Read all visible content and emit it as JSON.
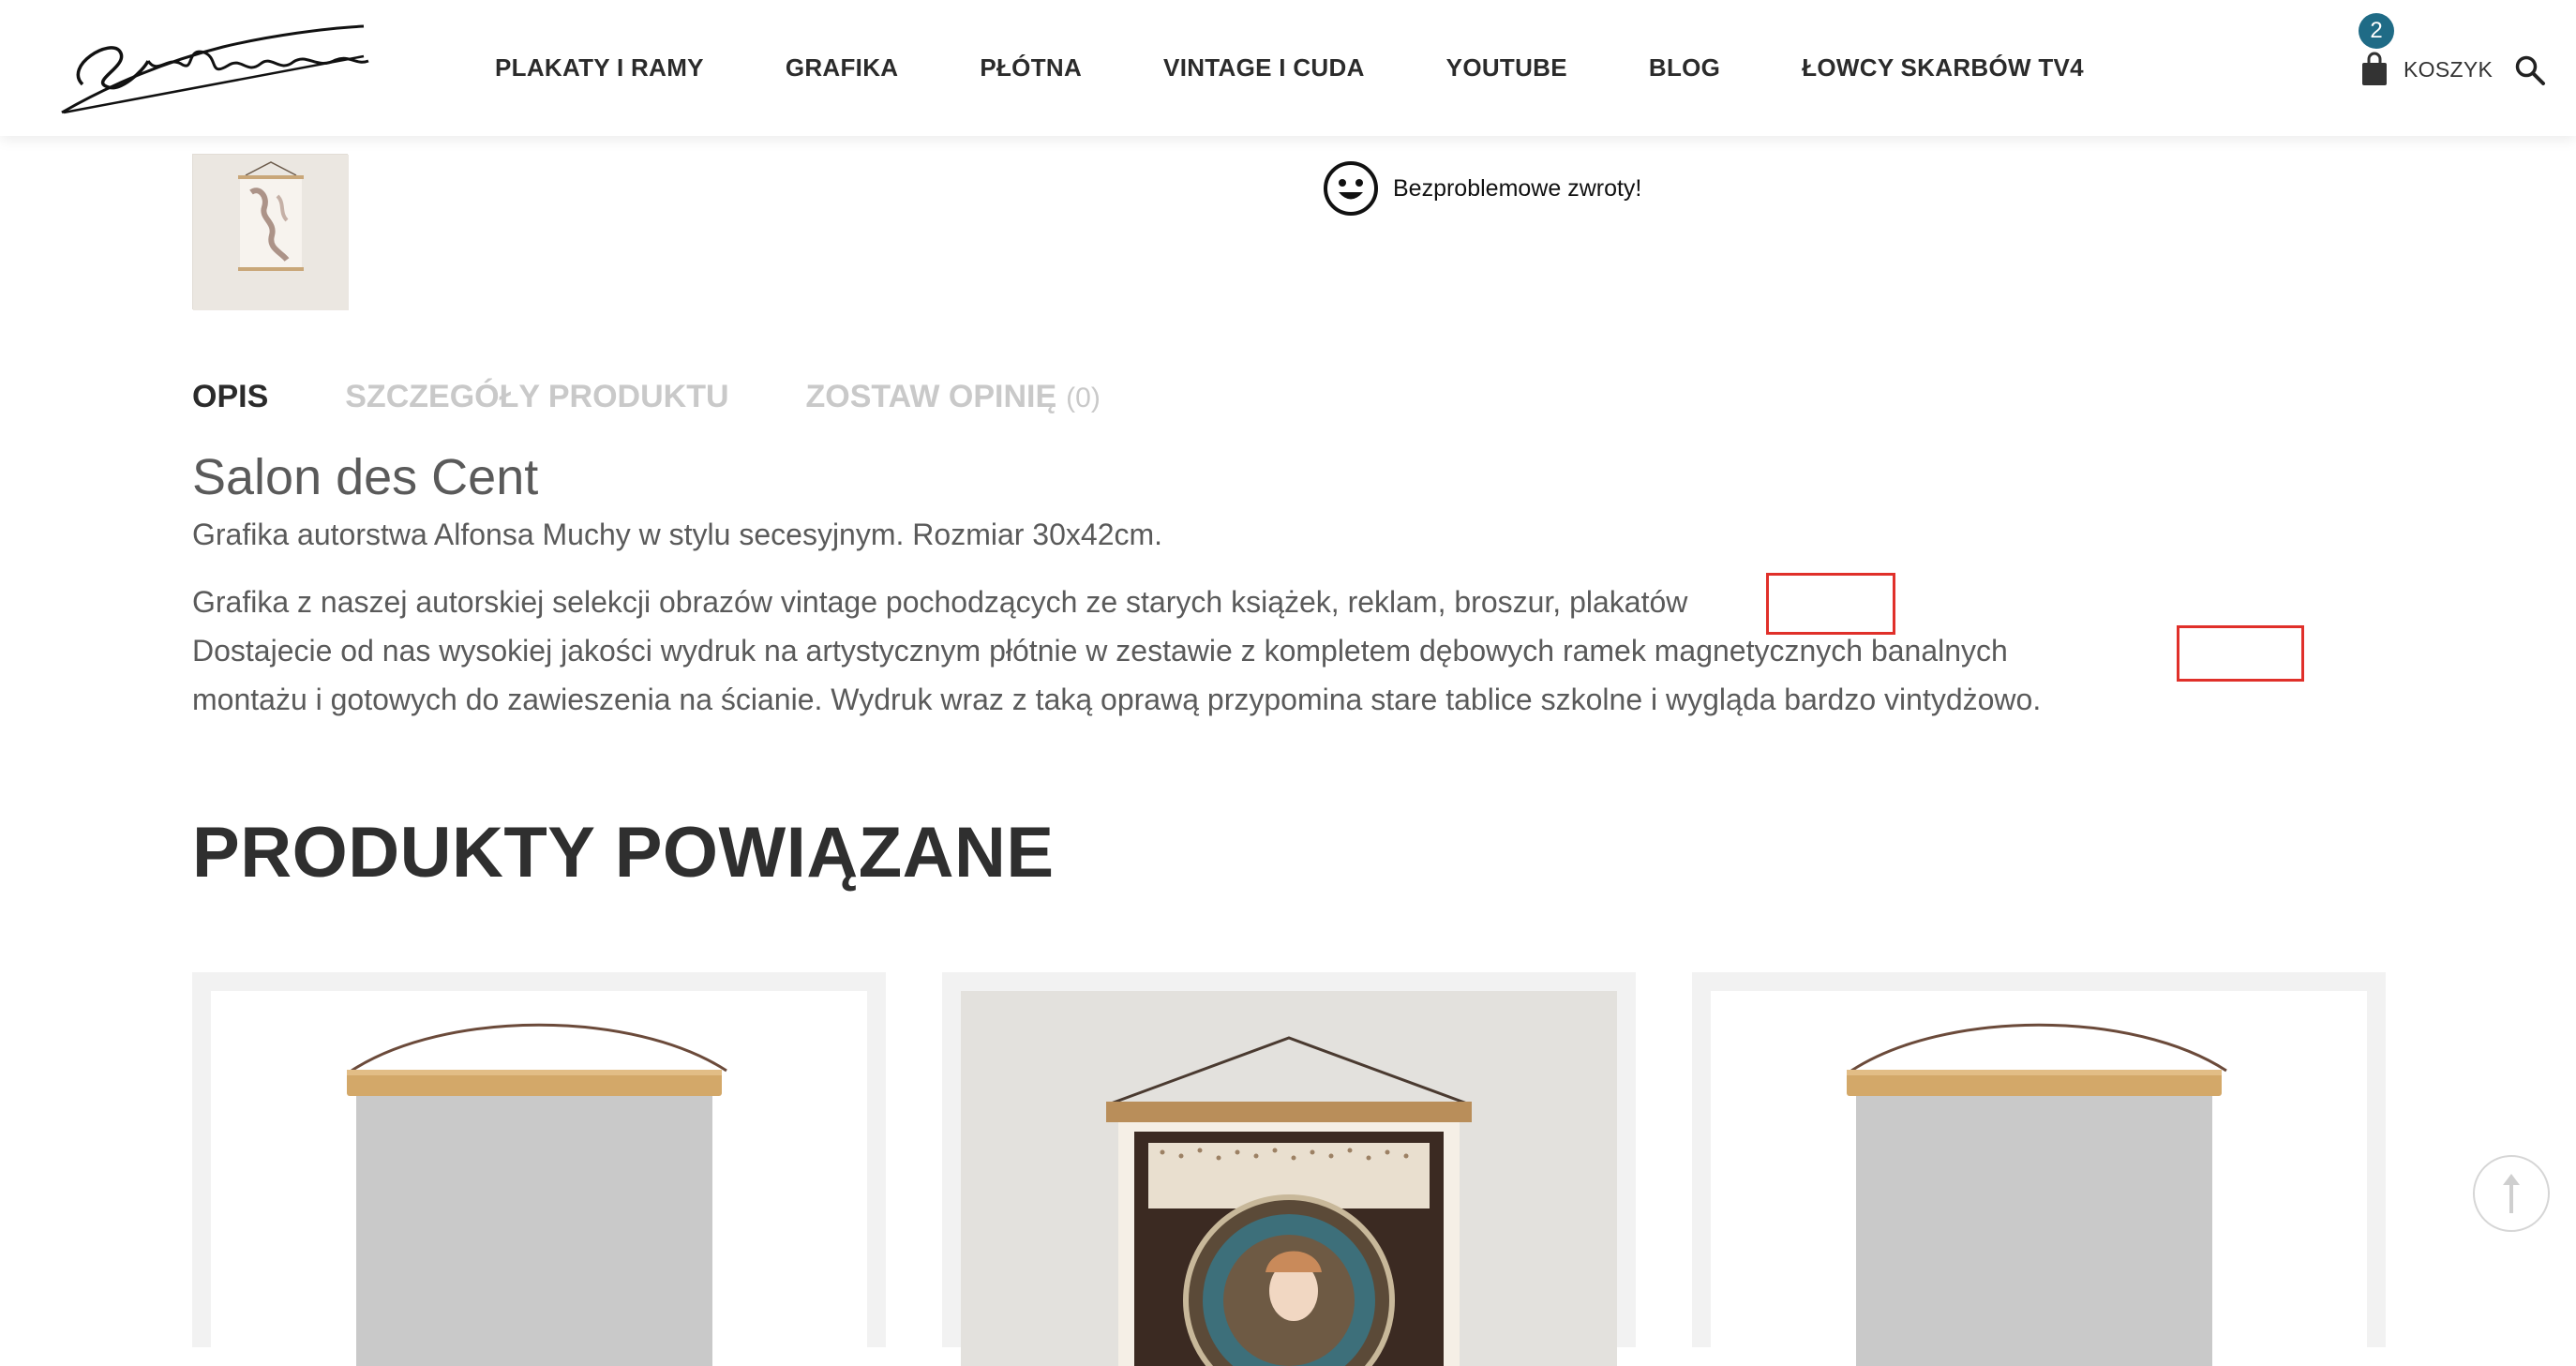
{
  "header": {
    "logo_text": "Szpejer",
    "nav": [
      {
        "label": "PLAKATY I RAMY"
      },
      {
        "label": "GRAFIKA"
      },
      {
        "label": "PŁÓTNA"
      },
      {
        "label": "VINTAGE I CUDA"
      },
      {
        "label": "YOUTUBE"
      },
      {
        "label": "BLOG"
      },
      {
        "label": "ŁOWCY SKARBÓW TV4"
      }
    ],
    "cart": {
      "count": "2",
      "label": "KOSZYK",
      "icon": "shopping-bag-icon"
    },
    "search_icon": "search-icon"
  },
  "product": {
    "returns_text": "Bezproblemowe zwroty!",
    "returns_icon": "smiley-icon",
    "tabs": [
      {
        "label": "OPIS",
        "active": true
      },
      {
        "label": "SZCZEGÓŁY PRODUKTU",
        "active": false
      },
      {
        "label": "ZOSTAW OPINIĘ",
        "count": "(0)",
        "active": false
      }
    ],
    "title": "Salon des Cent",
    "subtitle": "Grafika autorstwa Alfonsa Muchy w stylu secesyjnym. Rozmiar 30x42cm.",
    "description_lines": [
      "Grafika z naszej autorskiej selekcji obrazów vintage pochodzących ze starych książek, reklam, broszur, plakatów",
      "Dostajecie od nas wysokiej jakości wydruk na artystycznym płótnie w zestawie z kompletem dębowych ramek magnetycznych banalnych",
      "montażu i gotowych do zawieszenia na ścianie. Wydruk wraz z taką oprawą przypomina stare tablice szkolne i wygląda bardzo vintydżowo."
    ]
  },
  "related": {
    "title": "PRODUKTY POWIĄZANE"
  },
  "colors": {
    "accent_badge": "#1f6b86",
    "highlight": "#e0302a",
    "text_primary": "#2b2b2b",
    "text_body": "#5a5a5a",
    "tab_inactive": "#c9c9c9"
  }
}
